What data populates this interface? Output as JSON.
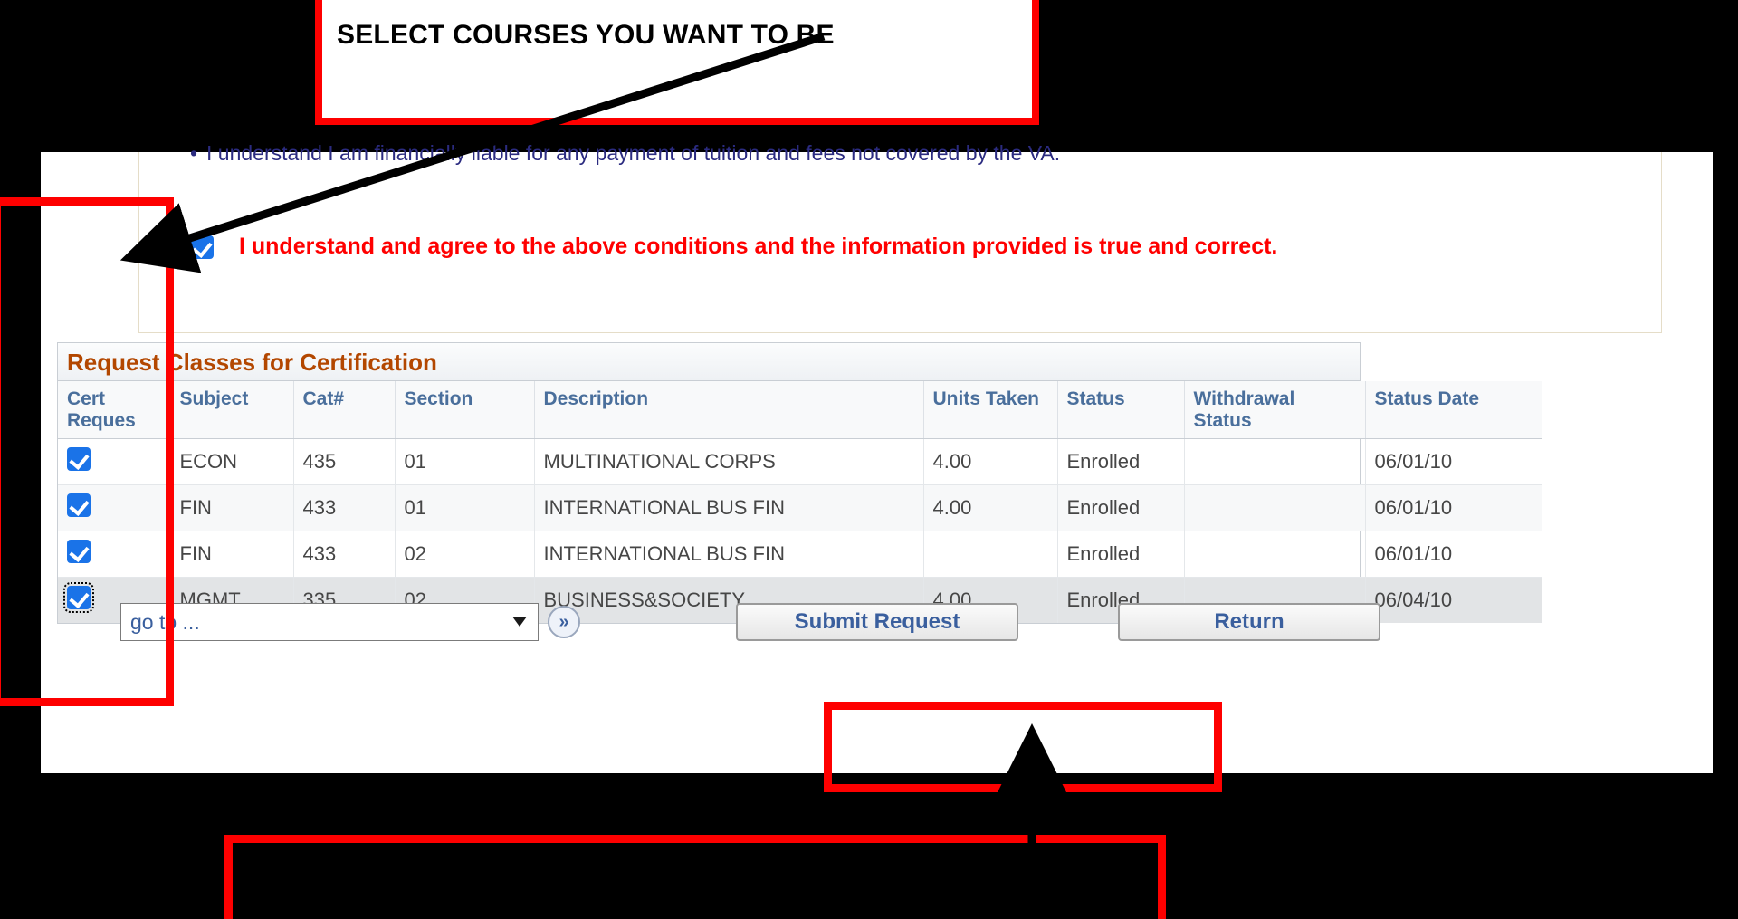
{
  "annotations": {
    "top_callout": "SELECT COURSES YOU WANT TO BE",
    "bottom_callout": ""
  },
  "conditions": {
    "bullet": "I understand I am financially liable for any payment of tuition and fees not covered by the VA.",
    "agreement_text": "I understand and agree to the above conditions and the information provided is true and correct.",
    "agreement_checked": true,
    "agreement_color": "#ff0000"
  },
  "grid": {
    "title": "Request Classes for Certification",
    "columns": [
      "Cert Reques",
      "Subject",
      "Cat#",
      "Section",
      "Description",
      "Units Taken",
      "Status",
      "Withdrawal Status",
      "Status Date"
    ],
    "rows": [
      {
        "cert_request": true,
        "focused": false,
        "subject": "ECON",
        "catalog": "435",
        "section": "01",
        "description": "MULTINATIONAL CORPS",
        "units_taken": "4.00",
        "status": "Enrolled",
        "withdrawal_status": "",
        "status_date": "06/01/10"
      },
      {
        "cert_request": true,
        "focused": false,
        "subject": "FIN",
        "catalog": "433",
        "section": "01",
        "description": "INTERNATIONAL BUS FIN",
        "units_taken": "4.00",
        "status": "Enrolled",
        "withdrawal_status": "",
        "status_date": "06/01/10"
      },
      {
        "cert_request": true,
        "focused": false,
        "subject": "FIN",
        "catalog": "433",
        "section": "02",
        "description": "INTERNATIONAL BUS FIN",
        "units_taken": "",
        "status": "Enrolled",
        "withdrawal_status": "",
        "status_date": "06/01/10"
      },
      {
        "cert_request": true,
        "focused": true,
        "subject": "MGMT",
        "catalog": "335",
        "section": "02",
        "description": "BUSINESS&SOCIETY",
        "units_taken": "4.00",
        "status": "Enrolled",
        "withdrawal_status": "",
        "status_date": "06/04/10"
      }
    ]
  },
  "footer": {
    "goto_value": "go to ...",
    "goto_go_icon": "double-chevron-right-icon",
    "submit_label": "Submit Request",
    "return_label": "Return"
  },
  "colors": {
    "annotation_red": "#fe0000",
    "grid_title": "#b34700",
    "header_text": "#4a6f9c",
    "checkbox_blue": "#1a73e8",
    "link_blue": "#3a5f9e",
    "bullet_text": "#2b2b80"
  }
}
